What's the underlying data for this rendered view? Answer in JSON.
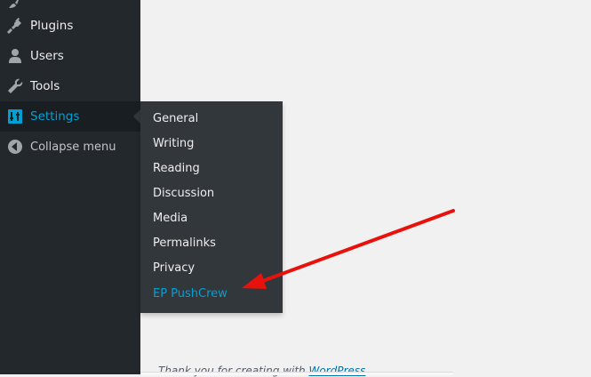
{
  "sidebar": {
    "items": [
      {
        "label": "Plugins",
        "icon": "plugin-icon"
      },
      {
        "label": "Users",
        "icon": "users-icon"
      },
      {
        "label": "Tools",
        "icon": "wrench-icon"
      },
      {
        "label": "Settings",
        "icon": "settings-sliders-icon",
        "active": true
      },
      {
        "label": "Collapse menu",
        "icon": "collapse-circle-icon"
      }
    ]
  },
  "submenu": {
    "items": [
      "General",
      "Writing",
      "Reading",
      "Discussion",
      "Media",
      "Permalinks",
      "Privacy",
      "EP PushCrew"
    ],
    "highlighted": "EP PushCrew"
  },
  "footer": {
    "text": "Thank you for creating with ",
    "link": "WordPress"
  },
  "annotation": {
    "color": "#e8120c",
    "icon": "red-arrow-icon"
  },
  "colors": {
    "sidebar_bg": "#23282d",
    "submenu_bg": "#32373c",
    "accent": "#00a0d2",
    "page_bg": "#f1f1f1"
  }
}
